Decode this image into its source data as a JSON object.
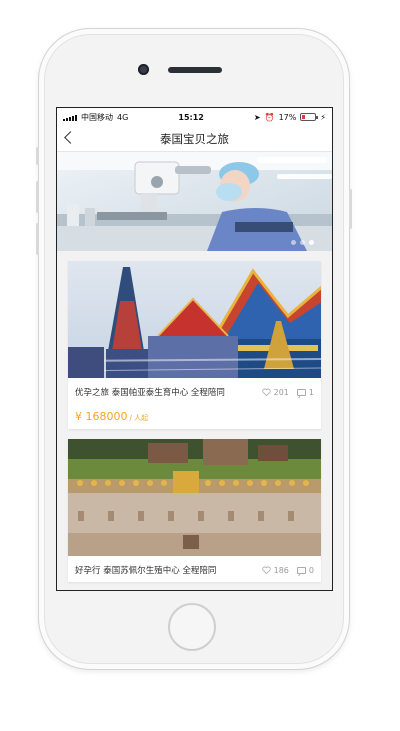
{
  "status_bar": {
    "carrier": "中国移动",
    "network": "4G",
    "time": "15:12",
    "battery": "17%"
  },
  "header": {
    "title": "泰国宝贝之旅"
  },
  "banner": {
    "slide_count": 3,
    "active_index": 2
  },
  "cards": [
    {
      "title": "优孕之旅 泰国帕亚泰生育中心 全程陪同",
      "likes": "201",
      "comments": "1",
      "price": "¥ 168000",
      "unit": "/ 人起"
    },
    {
      "title": "好孕行 泰国苏佩尔生殖中心 全程陪同",
      "likes": "186",
      "comments": "0"
    }
  ],
  "colors": {
    "accent": "#f5a623",
    "battery_low": "#e53935"
  }
}
